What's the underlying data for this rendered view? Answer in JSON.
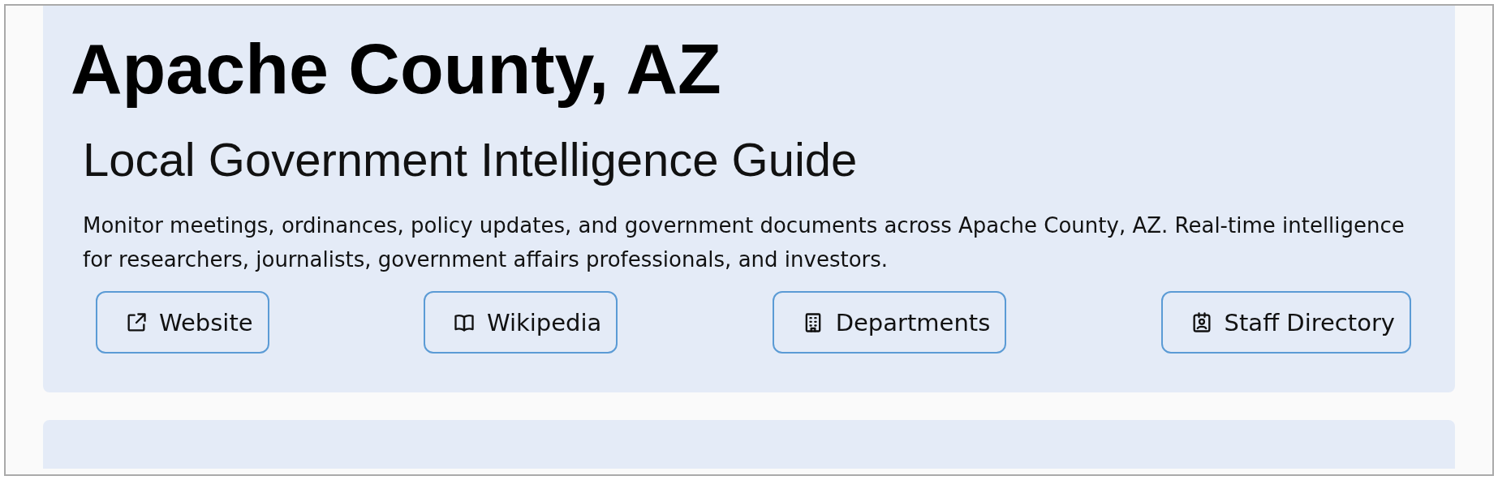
{
  "header": {
    "title": "Apache County, AZ",
    "subtitle": "Local Government Intelligence Guide",
    "description": "Monitor meetings, ordinances, policy updates, and government documents across Apache County, AZ. Real-time intelligence for researchers, journalists, government affairs professionals, and investors."
  },
  "links": [
    {
      "label": "Website",
      "kind": "external"
    },
    {
      "label": "Wikipedia",
      "kind": "book"
    },
    {
      "label": "Departments",
      "kind": "building"
    },
    {
      "label": "Staff Directory",
      "kind": "badge"
    }
  ]
}
